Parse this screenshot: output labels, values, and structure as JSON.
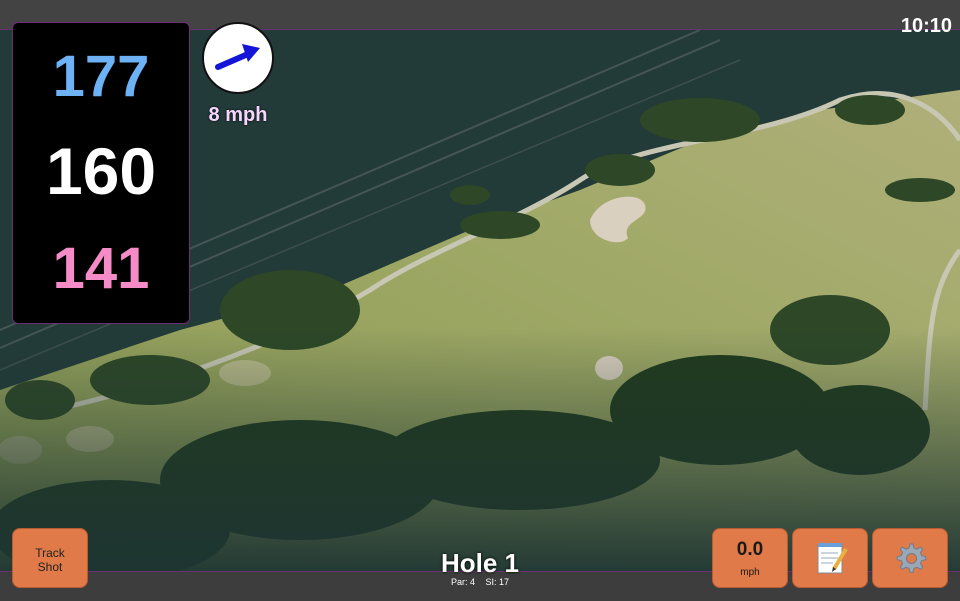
{
  "status": {
    "time": "10:10"
  },
  "distances": {
    "back": "177",
    "middle": "160",
    "front": "141"
  },
  "wind": {
    "speed": "8 mph",
    "icon": "wind-direction-arrow-icon"
  },
  "buttons": {
    "track_line1": "Track",
    "track_line2": "Shot",
    "speed_value": "0.0",
    "speed_unit": "mph",
    "notes_icon": "notepad-icon",
    "settings_icon": "gear-icon"
  },
  "hole": {
    "title": "Hole 1",
    "par": "Par: 4",
    "si": "SI: 17"
  },
  "colors": {
    "back_distance": "#6cb2f5",
    "middle_distance": "#ffffff",
    "front_distance": "#f58cc8",
    "button": "#e07a48",
    "accent_border": "#6b2f74"
  }
}
